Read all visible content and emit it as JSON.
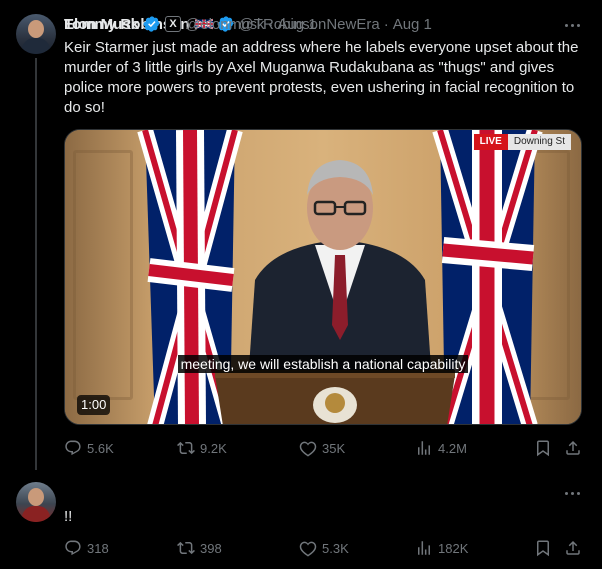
{
  "tweets": [
    {
      "name": "Tommy Robinson",
      "handle": "@TRobinsonNewEra",
      "separator": "·",
      "date": "Aug 1",
      "text": "Keir Starmer just made an address where he labels everyone upset about the murder of 3 little girls by Axel Muganwa Rudakubana as \"thugs\" and gives police more powers to prevent protests, even ushering in facial recognition to do so!",
      "video": {
        "live_label": "LIVE",
        "location_label": "Downing St",
        "subtitle": "meeting, we will establish a national capability",
        "duration": "1:00"
      },
      "stats": {
        "replies": "5.6K",
        "reposts": "9.2K",
        "likes": "35K",
        "views": "4.2M"
      }
    },
    {
      "name": "Elon Musk",
      "handle": "@elonmusk",
      "separator": "·",
      "date": "Aug 1",
      "badge": "X",
      "text": "!!",
      "stats": {
        "replies": "318",
        "reposts": "398",
        "likes": "5.3K",
        "views": "182K"
      }
    }
  ],
  "icons": [
    "uk-flag-icon",
    "verified-icon",
    "x-badge-icon",
    "more-icon",
    "reply-icon",
    "repost-icon",
    "like-icon",
    "views-icon",
    "bookmark-icon",
    "share-icon"
  ],
  "colors": {
    "background": "#000000",
    "text": "#e7e9ea",
    "muted": "#71767b",
    "verified": "#1d9bf0",
    "live": "#d5141b"
  }
}
